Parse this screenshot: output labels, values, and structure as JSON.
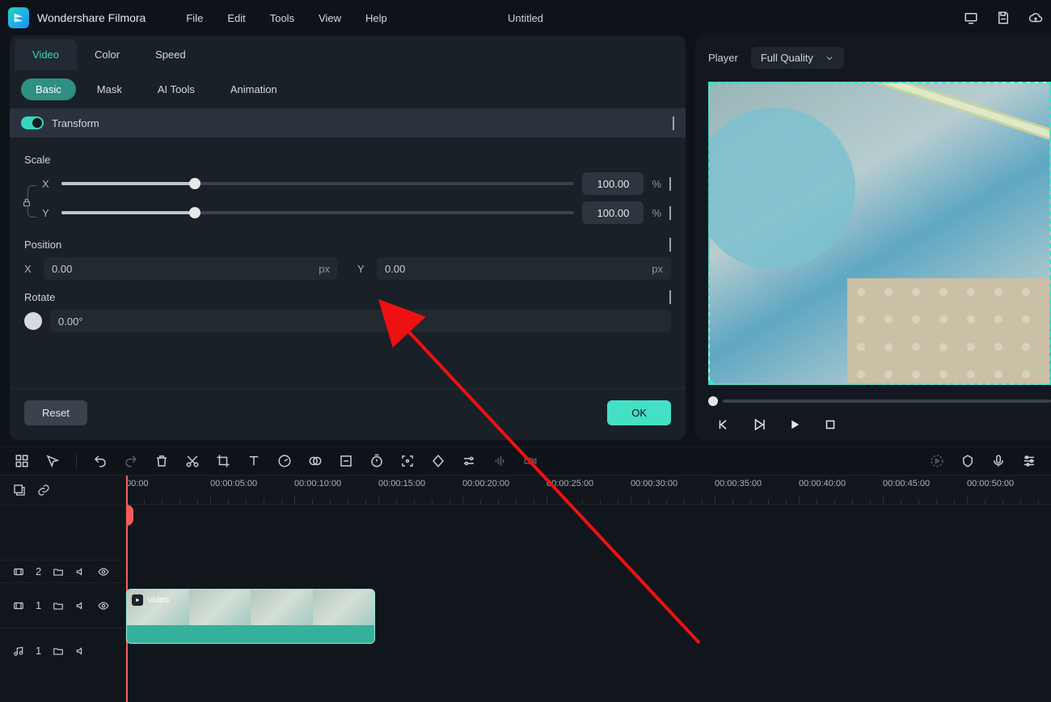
{
  "app": {
    "name": "Wondershare Filmora",
    "document": "Untitled"
  },
  "menubar": [
    "File",
    "Edit",
    "Tools",
    "View",
    "Help"
  ],
  "tabs_primary": [
    "Video",
    "Color",
    "Speed"
  ],
  "tabs_primary_active": 0,
  "tabs_secondary": [
    "Basic",
    "Mask",
    "AI Tools",
    "Animation"
  ],
  "tabs_secondary_active": 0,
  "transform": {
    "title": "Transform",
    "scale_label": "Scale",
    "scale_x_value": "100.00",
    "scale_y_value": "100.00",
    "percent": "%",
    "position_label": "Position",
    "pos_x": "0.00",
    "pos_y": "0.00",
    "px": "px",
    "rotate_label": "Rotate",
    "rotate_value": "0.00°",
    "axis_x": "X",
    "axis_y": "Y"
  },
  "buttons": {
    "reset": "Reset",
    "ok": "OK"
  },
  "player": {
    "label": "Player",
    "quality": "Full Quality"
  },
  "timeline": {
    "ticks": [
      "00:00",
      "00:00:05:00",
      "00:00:10:00",
      "00:00:15:00",
      "00:00:20:00",
      "00:00:25:00",
      "00:00:30:00",
      "00:00:35:00",
      "00:00:40:00",
      "00:00:45:00",
      "00:00:50:00"
    ],
    "track_v2": "2",
    "track_v1": "1",
    "track_a1": "1",
    "clip_name": "video"
  }
}
